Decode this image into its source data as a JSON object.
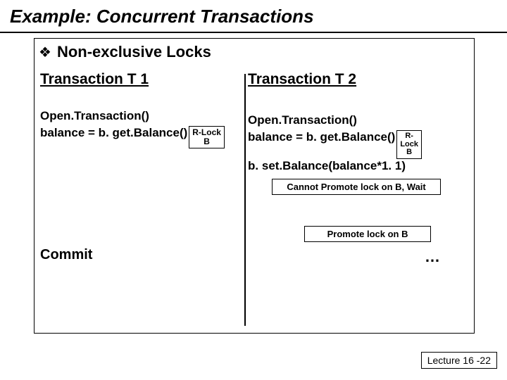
{
  "title": "Example: Concurrent Transactions",
  "bullet": {
    "icon": "❖",
    "text": "Non-exclusive Locks"
  },
  "t1": {
    "heading": "Transaction T 1",
    "open": "Open.Transaction()",
    "getbal": "balance = b. get.Balance()",
    "lock": {
      "l1": "R-Lock",
      "l2": "B"
    },
    "commit": "Commit"
  },
  "t2": {
    "heading": "Transaction T 2",
    "open": "Open.Transaction()",
    "getbal": "balance = b. get.Balance()",
    "lock": {
      "l1": "R-",
      "l2": "Lock",
      "l3": "B"
    },
    "setbal": "b. set.Balance(balance*1. 1)",
    "note1": "Cannot Promote lock on B, Wait",
    "note2": "Promote lock on B",
    "ellipsis": "…"
  },
  "footer": "Lecture 16 -22"
}
